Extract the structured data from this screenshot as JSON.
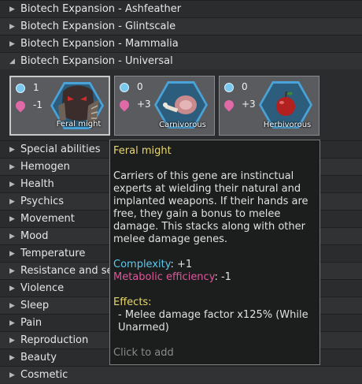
{
  "top_categories": [
    {
      "label": "Biotech Expansion - Ashfeather",
      "expanded": false
    },
    {
      "label": "Biotech Expansion - Glintscale",
      "expanded": false
    },
    {
      "label": "Biotech Expansion - Mammalia",
      "expanded": false
    },
    {
      "label": "Biotech Expansion - Universal",
      "expanded": true
    }
  ],
  "genes": [
    {
      "name": "Feral might",
      "complexity": "1",
      "metabolic": "-1",
      "icon": "feral-might-icon",
      "selected": true
    },
    {
      "name": "Carnivorous",
      "complexity": "0",
      "metabolic": "+3",
      "icon": "meat-icon",
      "selected": false
    },
    {
      "name": "Herbivorous",
      "complexity": "0",
      "metabolic": "+3",
      "icon": "apple-icon",
      "selected": false
    }
  ],
  "categories": [
    "Special abilities",
    "Hemogen",
    "Health",
    "Psychics",
    "Movement",
    "Mood",
    "Temperature",
    "Resistance and se",
    "Violence",
    "Sleep",
    "Pain",
    "Reproduction",
    "Beauty",
    "Cosmetic"
  ],
  "tooltip": {
    "title": "Feral might",
    "description": "Carriers of this gene are instinctual experts at wielding their natural and implanted weapons. If their hands are free, they gain a bonus to melee damage. This stacks along with other melee damage genes.",
    "complexity_label": "Complexity",
    "complexity_value": ": +1",
    "metabolic_label": "Metabolic efficiency",
    "metabolic_value": ": -1",
    "effects_title": "Effects:",
    "effect_line": "- Melee damage factor x125% (While Unarmed)",
    "click_hint": "Click to add"
  },
  "colors": {
    "tooltip_title": "#e7d774",
    "complexity": "#5fc8ee",
    "metabolic": "#e0569c",
    "hex_border": "#4aa3d8"
  }
}
